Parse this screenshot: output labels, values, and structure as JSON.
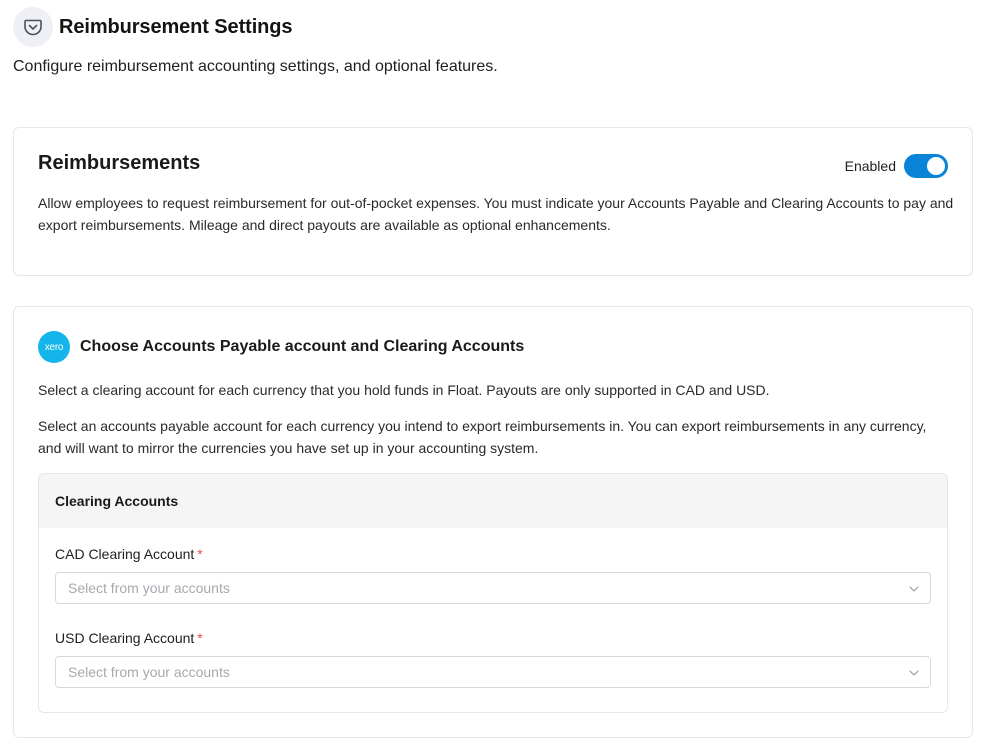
{
  "header": {
    "title": "Reimbursement Settings",
    "subtitle": "Configure reimbursement accounting settings, and optional features.",
    "icon": "pocket-icon"
  },
  "reimbursements": {
    "title": "Reimbursements",
    "toggle_label": "Enabled",
    "toggle_on": true,
    "description": "Allow employees to request reimbursement for out-of-pocket expenses. You must indicate your Accounts Payable and Clearing Accounts to pay and export reimbursements. Mileage and direct payouts are available as optional enhancements."
  },
  "accounts": {
    "logo_text": "xero",
    "title": "Choose Accounts Payable account and Clearing Accounts",
    "desc1": "Select a clearing account for each currency that you hold funds in Float. Payouts are only supported in CAD and USD.",
    "desc2": "Select an accounts payable account for each currency you intend to export reimbursements in. You can export reimbursements in any currency, and will want to mirror the currencies you have set up in your accounting system.",
    "panel_title": "Clearing Accounts",
    "required_mark": "*",
    "fields": [
      {
        "label": "CAD Clearing Account",
        "placeholder": "Select from your accounts"
      },
      {
        "label": "USD Clearing Account",
        "placeholder": "Select from your accounts"
      }
    ]
  },
  "colors": {
    "accent": "#0a84d6",
    "xero": "#13b5ea",
    "required": "#e05252"
  }
}
